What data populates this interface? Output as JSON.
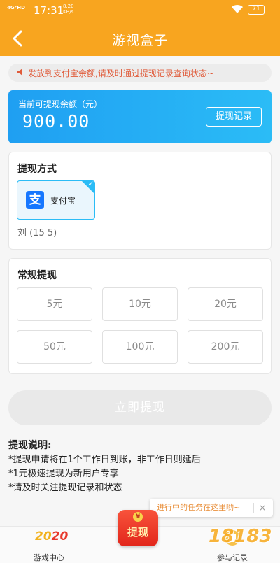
{
  "status_bar": {
    "signal": "4G⁺HD",
    "time": "17:31",
    "speed_value": "8.20",
    "speed_unit": "KB/s",
    "battery": "71"
  },
  "app_bar": {
    "title": "游视盒子"
  },
  "notice": {
    "text": "发放到支付宝余额,请及时通过提现记录查询状态~"
  },
  "balance": {
    "label": "当前可提现余额（元）",
    "amount": "900.00",
    "record_button": "提现记录"
  },
  "withdraw_method": {
    "heading": "提现方式",
    "option": {
      "name": "支付宝",
      "logo_glyph": "支",
      "icon": "alipay-icon"
    },
    "account": "刘 (15 5)"
  },
  "regular_withdraw": {
    "heading": "常规提现",
    "amounts": [
      "5元",
      "10元",
      "20元",
      "50元",
      "100元",
      "200元"
    ]
  },
  "submit_button": "立即提现",
  "rules": {
    "title": "提现说明:",
    "items": [
      "*提现申请将在1个工作日到账，非工作日则延后",
      "*1元极速提现为新用户专享",
      "*请及时关注提现记录和状态"
    ]
  },
  "tooltip": {
    "text": "进行中的任务在这里哟~",
    "close": "×"
  },
  "tab_bar": {
    "game_center": {
      "label": "游戏中心",
      "icon_text_a": "20",
      "icon_text_b": "20"
    },
    "withdraw": {
      "label": "提现",
      "coin": "¥"
    },
    "records": {
      "label": "参与记录"
    }
  },
  "watermark": "18183",
  "colors": {
    "brand_orange": "#f8a51f",
    "balance_blue": "#1f9ff2",
    "alipay_blue": "#1677ff",
    "notice_red": "#e05b3a"
  }
}
